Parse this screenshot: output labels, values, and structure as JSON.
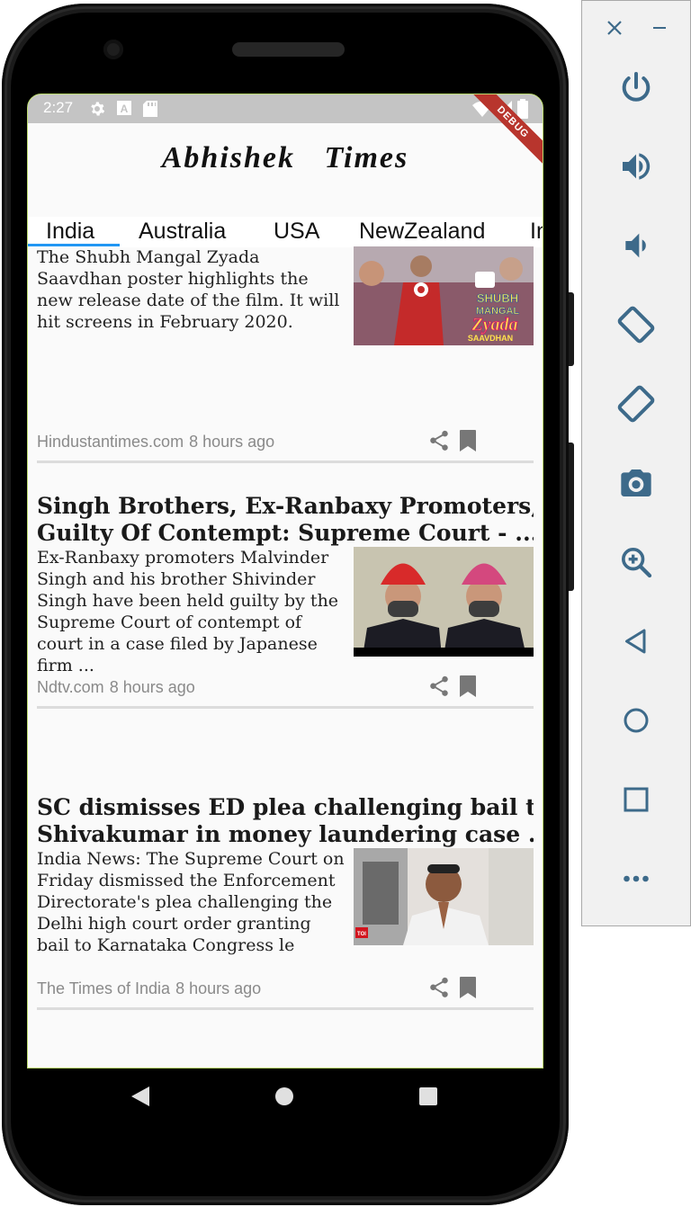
{
  "status_bar": {
    "time": "2:27",
    "debug_label": "DEBUG"
  },
  "app": {
    "title": "Abhishek Times"
  },
  "tabs": [
    {
      "label": "India",
      "selected": true
    },
    {
      "label": "Australia"
    },
    {
      "label": "USA"
    },
    {
      "label": "NewZealand"
    },
    {
      "label": "In"
    }
  ],
  "articles": [
    {
      "title": "",
      "description": "The Shubh Mangal Zyada Saavdhan poster highlights the new release date of the film. It will hit screens in February 2020.",
      "source": "Hindustantimes.com",
      "time": "8 hours ago",
      "image_text": {
        "line1": "SHUBH",
        "line2": "MANGAL",
        "line3": "Zyada",
        "line4": "SAAVDHAN"
      }
    },
    {
      "title": "Singh Brothers, Ex-Ranbaxy Promoters, Guilty Of Contempt: Supreme Court - ...",
      "title_line1": "Singh Brothers, Ex-Ranbaxy Promoters,",
      "title_line2": "Guilty Of Contempt: Supreme Court - ...",
      "description": "Ex-Ranbaxy promoters Malvinder Singh and his brother Shivinder Singh have been held guilty by the Supreme Court of contempt of court in a case filed by Japanese firm ...",
      "source": "Ndtv.com",
      "time": "8 hours ago"
    },
    {
      "title": "SC dismisses ED plea challenging bail to Shivakumar in money laundering case ...",
      "title_line1": "SC dismisses ED plea challenging bail to",
      "title_line2": "Shivakumar in money laundering case ...",
      "description": "India News: The Supreme Court on Friday dismissed the Enforcement Directorate's plea challenging the Delhi high court order granting bail to Karnataka Congress le",
      "source": "The Times of India",
      "time": "8 hours ago",
      "image_text": {
        "badge": "TOI"
      }
    }
  ],
  "icons": {
    "share": "share-icon",
    "bookmark": "bookmark-icon",
    "emulator": [
      "close-icon",
      "minimize-icon",
      "power-icon",
      "volume-up-icon",
      "volume-down-icon",
      "rotate-left-icon",
      "rotate-right-icon",
      "camera-icon",
      "zoom-icon",
      "back-icon",
      "home-icon",
      "overview-icon",
      "more-icon"
    ]
  },
  "colors": {
    "tab_indicator": "#2196f3",
    "debug_ribbon": "#b8352d",
    "emulator_icon": "#3d6a8a"
  }
}
